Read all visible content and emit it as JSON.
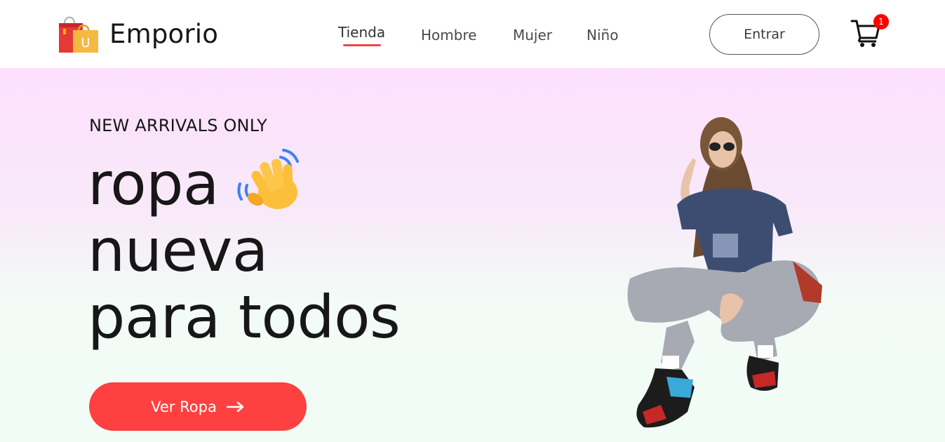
{
  "header": {
    "brand": "Emporio",
    "nav": [
      {
        "label": "Tienda",
        "active": true
      },
      {
        "label": "Hombre",
        "active": false
      },
      {
        "label": "Mujer",
        "active": false
      },
      {
        "label": "Niño",
        "active": false
      }
    ],
    "login_label": "Entrar",
    "cart_count": "1",
    "logo_bag_letter": "U"
  },
  "hero": {
    "eyebrow": "NEW ARRIVALS ONLY",
    "headline_lines": [
      "ropa",
      "nueva",
      "para todos"
    ],
    "cta_label": "Ver Ropa"
  },
  "icons": {
    "logo": "shopping-bags-icon",
    "cart": "shopping-cart-icon",
    "wave": "waving-hand-icon",
    "cta_arrow": "arrow-right-icon"
  },
  "colors": {
    "accent": "#ff4040",
    "nav_underline": "#ef4444",
    "badge": "#ff0000",
    "hero_top": "#fde0fd",
    "hero_bottom": "#f2fcf6",
    "text": "#171717"
  }
}
